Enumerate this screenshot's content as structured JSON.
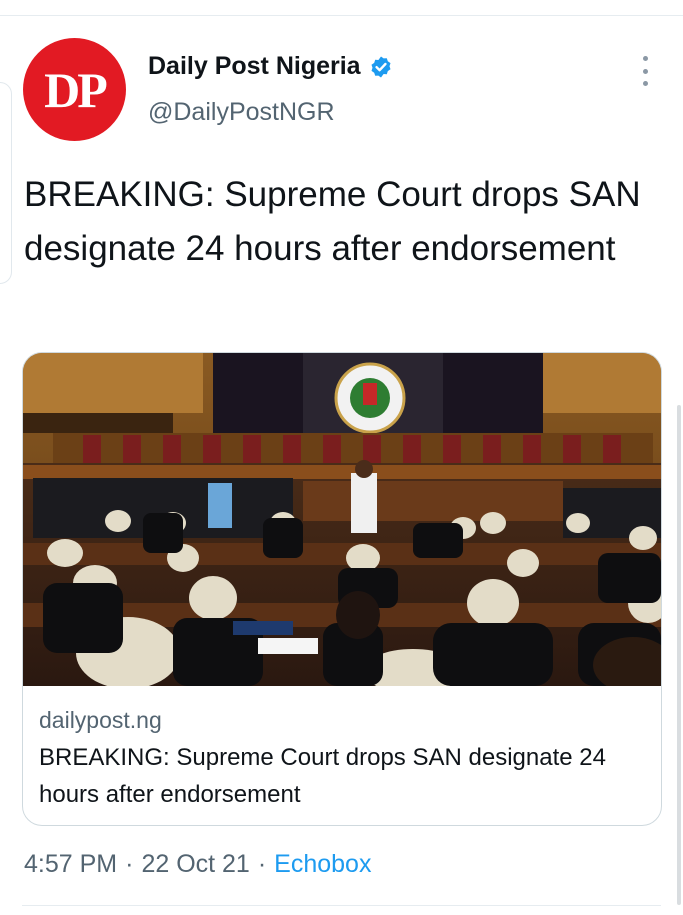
{
  "author": {
    "display_name": "Daily Post Nigeria",
    "handle": "@DailyPostNGR",
    "avatar_text": "DP",
    "verified_icon": "verified-badge-icon",
    "avatar_color": "#e21a23",
    "verified_color": "#1d9bf0"
  },
  "more_icon": "more-options-icon",
  "tweet": {
    "text": "BREAKING: Supreme Court drops SAN designate 24 hours after endorsement"
  },
  "card": {
    "image_icon": "courtroom-photo",
    "domain": "dailypost.ng",
    "title": "BREAKING: Supreme Court drops SAN designate 24 hours after endorsement"
  },
  "footer": {
    "time": "4:57 PM",
    "separator": "·",
    "date": "22 Oct 21",
    "source": "Echobox"
  },
  "colors": {
    "text_primary": "#0f1419",
    "text_secondary": "#536471",
    "link": "#1d9bf0",
    "border": "#cfd9de"
  }
}
